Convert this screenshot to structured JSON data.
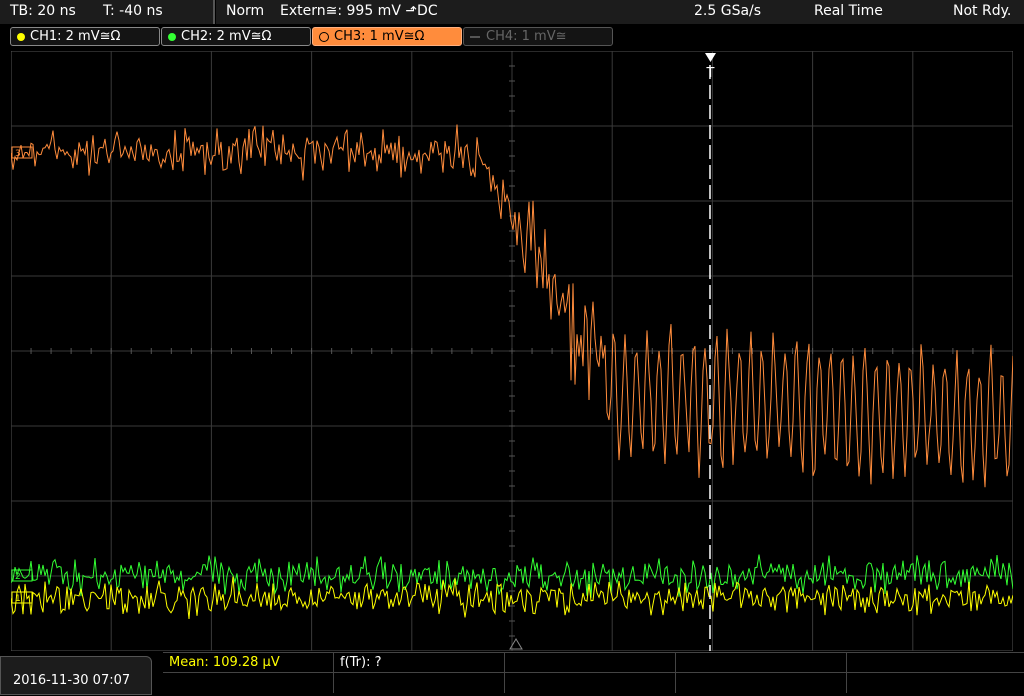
{
  "topbar": {
    "timebase": "TB: 20 ns",
    "offset": "T: -40 ns",
    "trigger_mode": "Norm",
    "trigger_source": "Extern≅: 995 mV ⬏DC",
    "sample_rate": "2.5 GSa/s",
    "acq_mode": "Real Time",
    "status": "Not Rdy."
  },
  "channels": [
    {
      "label": "CH1: 2 mV≅Ω",
      "color": "#ffff00",
      "active": true
    },
    {
      "label": "CH2: 2 mV≅Ω",
      "color": "#33ff33",
      "active": true
    },
    {
      "label": "CH3: 1 mV≅Ω",
      "color": "#ff8c3c",
      "active": true,
      "selected": true
    },
    {
      "label": "CH4: 1 mV≅",
      "color": "#666666",
      "active": false
    }
  ],
  "plot": {
    "trigger_marker": "T",
    "ch3_marker": "3",
    "ch2_marker": "2",
    "ch1_marker": "1"
  },
  "footer": {
    "datetime": "2016-11-30 07:07",
    "mean": "Mean: 109.28 µV",
    "ftr": "f(Tr): ?"
  }
}
